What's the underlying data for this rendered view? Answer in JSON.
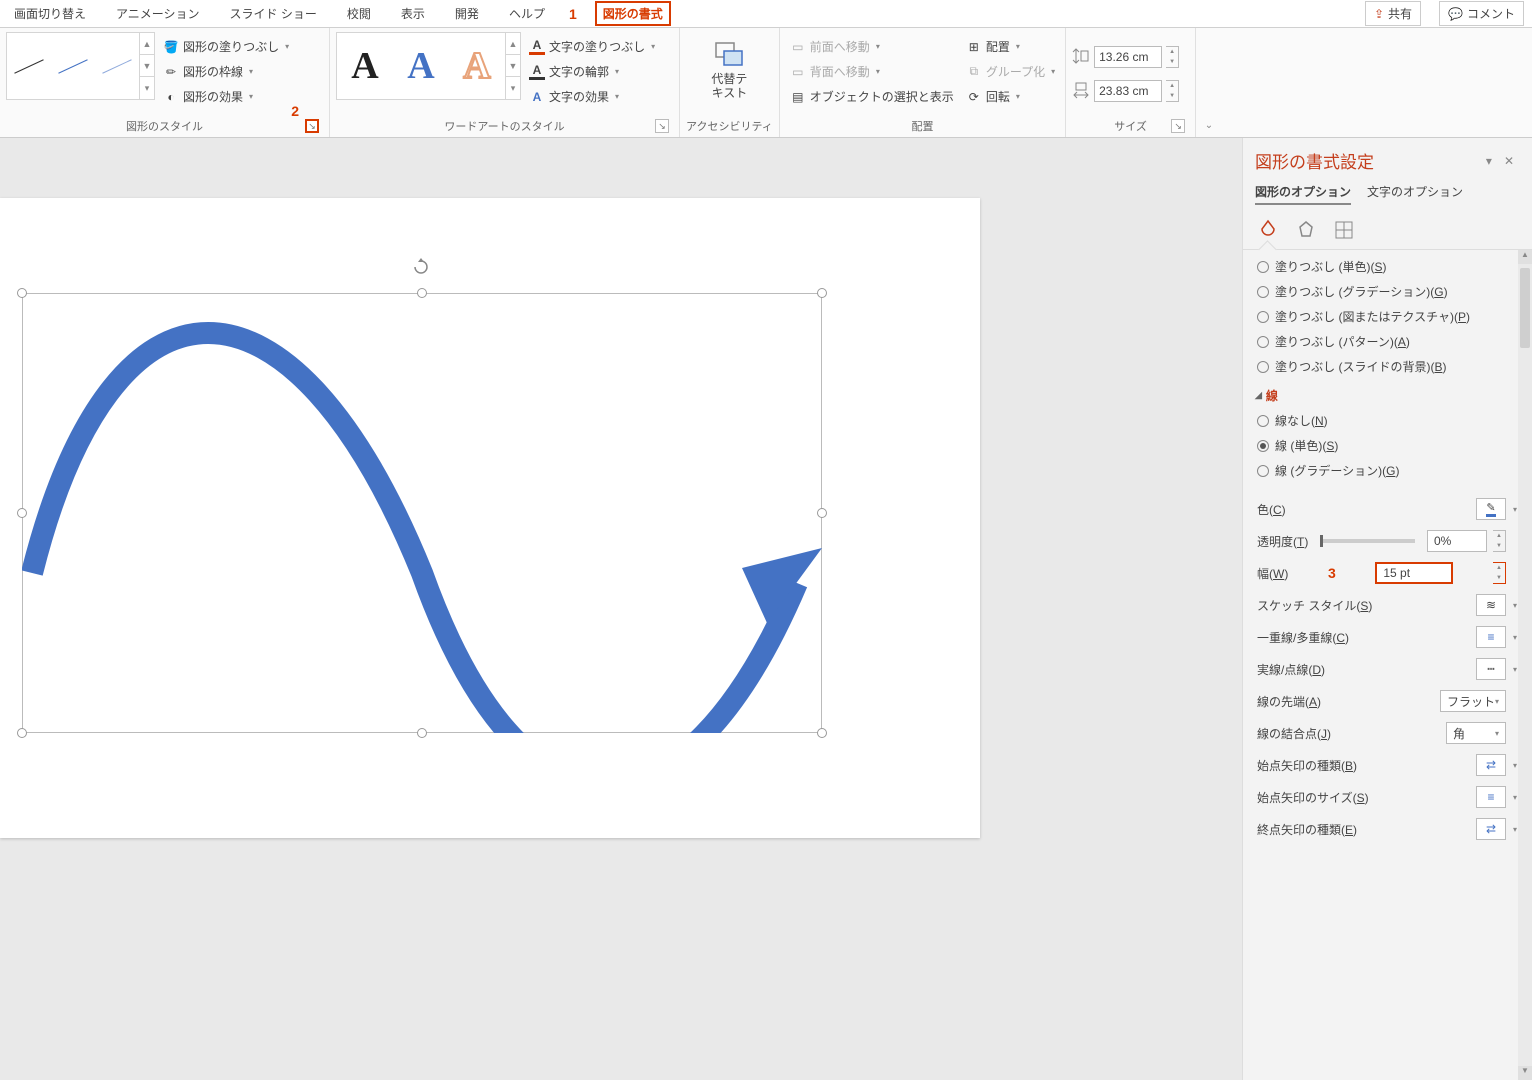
{
  "annotations": {
    "one": "1",
    "two": "2",
    "three": "3"
  },
  "tabs": {
    "transition": "画面切り替え",
    "animation": "アニメーション",
    "slideshow": "スライド ショー",
    "review": "校閲",
    "view": "表示",
    "developer": "開発",
    "help": "ヘルプ",
    "shape_format": "図形の書式"
  },
  "titlebar": {
    "share": "共有",
    "comment": "コメント"
  },
  "ribbon": {
    "shape_styles": {
      "label": "図形のスタイル",
      "fill": "図形の塗りつぶし",
      "outline": "図形の枠線",
      "effects": "図形の効果"
    },
    "wordart": {
      "label": "ワードアートのスタイル",
      "text_fill": "文字の塗りつぶし",
      "text_outline": "文字の輪郭",
      "text_effects": "文字の効果"
    },
    "accessibility": {
      "label": "アクセシビリティ",
      "alt_text": "代替テ\nキスト"
    },
    "arrange": {
      "label": "配置",
      "bring_forward": "前面へ移動",
      "send_backward": "背面へ移動",
      "selection_pane": "オブジェクトの選択と表示",
      "align": "配置",
      "group": "グループ化",
      "rotate": "回転"
    },
    "size": {
      "label": "サイズ",
      "height": "13.26 cm",
      "width": "23.83 cm"
    }
  },
  "pane": {
    "title": "図形の書式設定",
    "tab_shape": "図形のオプション",
    "tab_text": "文字のオプション",
    "fill": {
      "solid": "塗りつぶし (単色)(",
      "solid_k": "S",
      "gradient": "塗りつぶし (グラデーション)(",
      "gradient_k": "G",
      "picture": "塗りつぶし (図またはテクスチャ)(",
      "picture_k": "P",
      "pattern": "塗りつぶし (パターン)(",
      "pattern_k": "A",
      "slidebg": "塗りつぶし (スライドの背景)(",
      "slidebg_k": "B"
    },
    "line_section": "線",
    "line": {
      "none": "線なし(",
      "none_k": "N",
      "solid": "線 (単色)(",
      "solid_k": "S",
      "gradient": "線 (グラデーション)(",
      "gradient_k": "G"
    },
    "props": {
      "color": "色(",
      "color_k": "C",
      "transparency": "透明度(",
      "transparency_k": "T",
      "transparency_val": "0%",
      "width": "幅(",
      "width_k": "W",
      "width_val": "15 pt",
      "sketch": "スケッチ スタイル(",
      "sketch_k": "S",
      "compound": "一重線/多重線(",
      "compound_k": "C",
      "dash": "実線/点線(",
      "dash_k": "D",
      "cap": "線の先端(",
      "cap_k": "A",
      "cap_val": "フラット",
      "join": "線の結合点(",
      "join_k": "J",
      "join_val": "角",
      "begin_type": "始点矢印の種類(",
      "begin_type_k": "B",
      "begin_size": "始点矢印のサイズ(",
      "begin_size_k": "S",
      "end_type": "終点矢印の種類(",
      "end_type_k": "E"
    },
    "close_paren": ")"
  }
}
